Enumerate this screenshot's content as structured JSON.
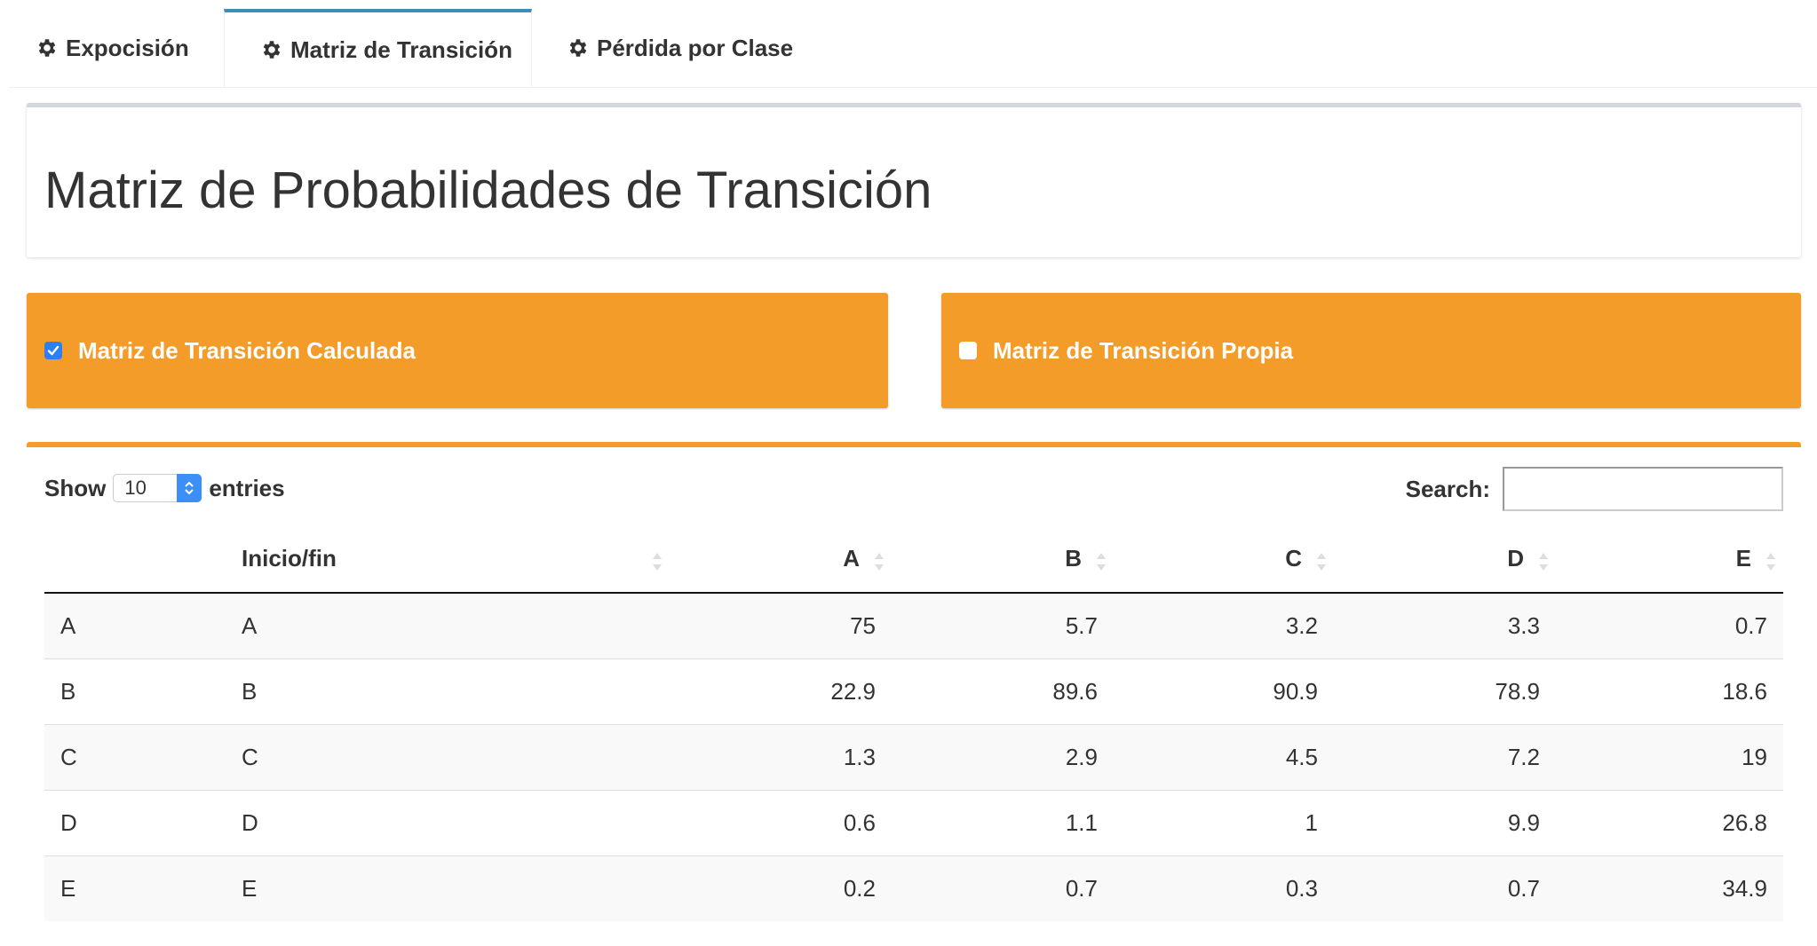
{
  "tabs": [
    {
      "label": "Expocisión",
      "active": false
    },
    {
      "label": "Matriz de Transición",
      "active": true
    },
    {
      "label": "Pérdida por Clase",
      "active": false
    }
  ],
  "page_title": "Matriz de Probabilidades de Transición",
  "options": {
    "calculated": {
      "label": "Matriz de Transición Calculada",
      "checked": true
    },
    "own": {
      "label": "Matriz de Transición Propia",
      "checked": false
    }
  },
  "table": {
    "show_label": "Show",
    "entries_label": "entries",
    "page_length": "10",
    "search_label": "Search:",
    "search_value": "",
    "columns": [
      "",
      "Inicio/fin",
      "A",
      "B",
      "C",
      "D",
      "E"
    ],
    "rows": [
      [
        "A",
        "A",
        "75",
        "5.7",
        "3.2",
        "3.3",
        "0.7"
      ],
      [
        "B",
        "B",
        "22.9",
        "89.6",
        "90.9",
        "78.9",
        "18.6"
      ],
      [
        "C",
        "C",
        "1.3",
        "2.9",
        "4.5",
        "7.2",
        "19"
      ],
      [
        "D",
        "D",
        "0.6",
        "1.1",
        "1",
        "9.9",
        "26.8"
      ],
      [
        "E",
        "E",
        "0.2",
        "0.7",
        "0.3",
        "0.7",
        "34.9"
      ]
    ]
  },
  "colors": {
    "accent_orange": "#f39c2a",
    "tab_active_border": "#3c8dbc",
    "checkbox_blue": "#2f7ef5"
  },
  "icons": {
    "tab_icon": "gear-icon",
    "sort_icon": "sort-both-icon"
  }
}
